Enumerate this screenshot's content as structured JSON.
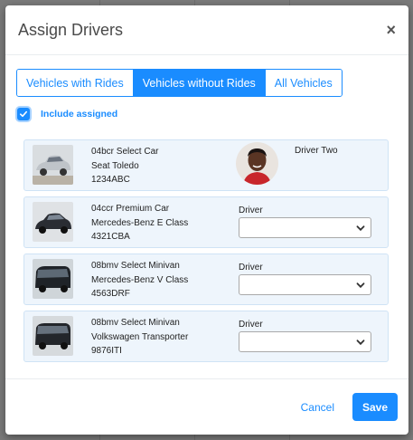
{
  "modal": {
    "title": "Assign Drivers",
    "close_label": "×"
  },
  "tabs": [
    {
      "label": "Vehicles with Rides",
      "active": false
    },
    {
      "label": "Vehicles without Rides",
      "active": true
    },
    {
      "label": "All Vehicles",
      "active": false
    }
  ],
  "include_assigned": {
    "label": "Include assigned",
    "checked": true
  },
  "vehicles": [
    {
      "code_class": "04bcr Select Car",
      "model": "Seat Toledo",
      "plate": "1234ABC",
      "assigned": true,
      "driver_name": "Driver Two",
      "car_color": "#bfc4c9"
    },
    {
      "code_class": "04ccr Premium Car",
      "model": "Mercedes-Benz E Class",
      "plate": "4321CBA",
      "assigned": false,
      "driver_label": "Driver",
      "select_value": "",
      "car_color": "#2a2d33"
    },
    {
      "code_class": "08bmv Select Minivan",
      "model": "Mercedes-Benz V Class",
      "plate": "4563DRF",
      "assigned": false,
      "driver_label": "Driver",
      "select_value": "",
      "car_color": "#1f2328"
    },
    {
      "code_class": "08bmv Select Minivan",
      "model": "Volkswagen Transporter",
      "plate": "9876ITI",
      "assigned": false,
      "driver_label": "Driver",
      "select_value": "",
      "car_color": "#23262b"
    }
  ],
  "footer": {
    "cancel_label": "Cancel",
    "save_label": "Save"
  },
  "colors": {
    "accent": "#1a8cff",
    "row_bg": "#eef5fc",
    "row_border": "#cfe3f5"
  }
}
